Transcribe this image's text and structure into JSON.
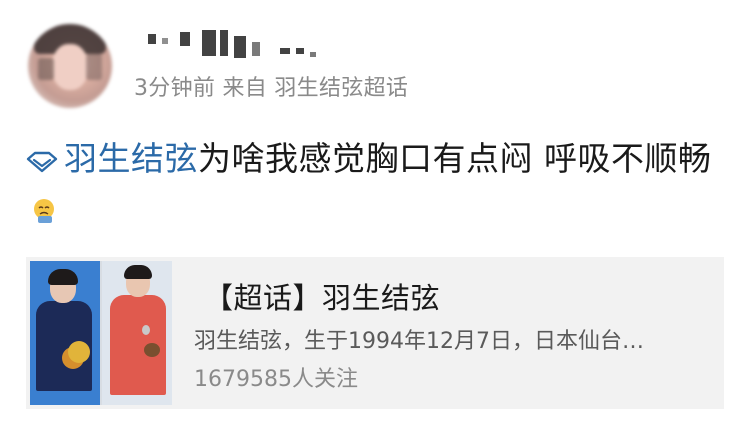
{
  "post": {
    "meta": "3分钟前  来自 羽生结弦超话",
    "topic": "羽生结弦",
    "text": "为啥我感觉胸口有点闷 呼吸不顺畅",
    "emoji_icon": "emoji-sad-face-icon",
    "topic_icon": "super-topic-diamond-icon",
    "topic_color": "#2b6aa8"
  },
  "card": {
    "title": "【超话】羽生结弦",
    "description": "羽生结弦，生于1994年12月7日，日本仙台…",
    "followers": "1679585人关注",
    "background": "#f2f2f2"
  }
}
